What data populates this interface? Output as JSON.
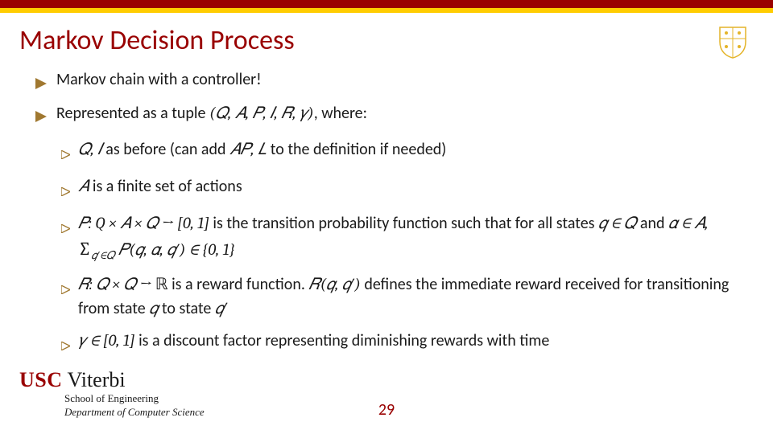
{
  "slide": {
    "title": "Markov Decision Process",
    "bullets": {
      "b1": "Markov chain with a controller!",
      "b2_pre": "Represented as a tuple ",
      "b2_tuple": "(𝑄, 𝐴, 𝑃, 𝐼, 𝑅, 𝛾)",
      "b2_post": ", where:",
      "s1_a": "𝑄, 𝐼",
      "s1_b": " as before (can add ",
      "s1_c": "𝐴𝑃, 𝐿",
      "s1_d": " to the definition if needed)",
      "s2_a": "𝐴",
      "s2_b": " is a finite set of actions",
      "s3_a": "𝑃: Q × 𝐴 × 𝑄 → [0, 1]",
      "s3_b": " is the transition probability function such that for all states ",
      "s3_c": "𝑞 ∈ 𝑄",
      "s3_d": " and ",
      "s3_e": "𝛼 ∈ 𝐴, ",
      "s3_f": "∑",
      "s3_fsub": "𝑞′∈𝑄",
      "s3_g": " 𝑃(𝑞, 𝛼, 𝑞′) ∈ {0, 1}",
      "s4_a": "𝑅: 𝑄 × 𝑄 → ",
      "s4_real": "ℝ",
      "s4_b": " is a reward function. ",
      "s4_c": "𝑅(𝑞, 𝑞′)",
      "s4_d": " defines the immediate reward received for transitioning from state ",
      "s4_e": "𝑞",
      "s4_f": " to state ",
      "s4_g": "𝑞′",
      "s5_a": "𝛾 ∈ [0, 1]",
      "s5_b": " is a discount factor representing diminishing rewards with time"
    }
  },
  "footer": {
    "usc": "USC",
    "viterbi": "Viterbi",
    "dept1": "School of Engineering",
    "dept2": "Department of Computer Science",
    "page": "29"
  },
  "colors": {
    "cardinal": "#990000",
    "gold": "#ffcc00"
  }
}
